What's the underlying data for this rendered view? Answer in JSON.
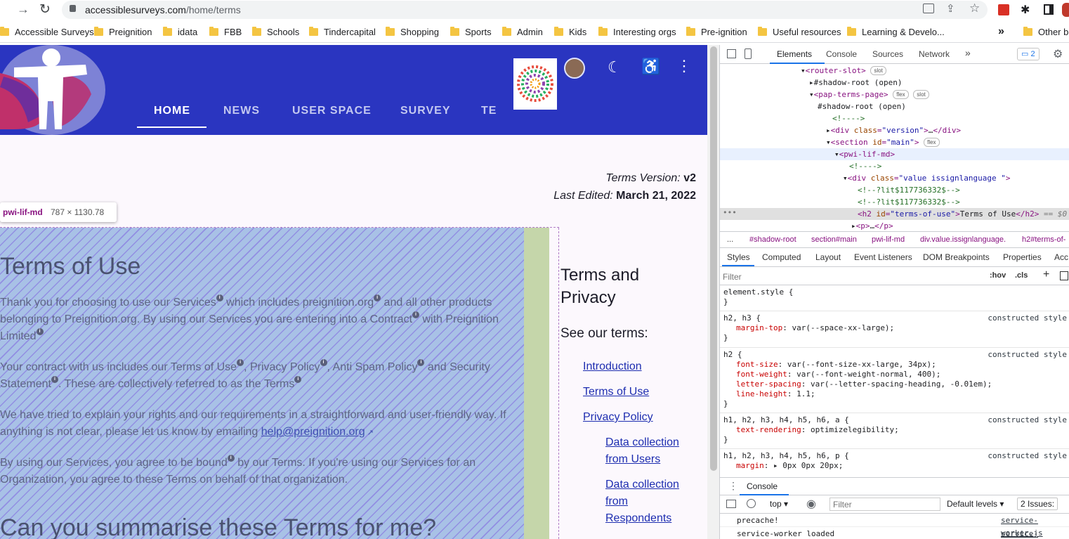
{
  "browser": {
    "url_domain": "accessiblesurveys.com",
    "url_path": "/home/terms",
    "bookmarks": [
      "Accessible Surveys",
      "Preignition",
      "idata",
      "FBB",
      "Schools",
      "Tindercapital",
      "Shopping",
      "Sports",
      "Admin",
      "Kids",
      "Interesting orgs",
      "Pre-ignition",
      "Useful resources",
      "Learning & Develo..."
    ],
    "bookmarks_more": "»",
    "other_bookmarks": "Other bo"
  },
  "page": {
    "nav": [
      "HOME",
      "NEWS",
      "USER SPACE",
      "SURVEY",
      "TE"
    ],
    "terms_version_label": "Terms Version:",
    "terms_version_value": "v2",
    "last_edited_label": "Last Edited:",
    "last_edited_value": "March 21, 2022",
    "inspect_tooltip_name": "pwi-lif-md",
    "inspect_tooltip_size": "787 × 1130.78",
    "heading": "Terms of Use",
    "para1": {
      "a": "Thank you for choosing to use our ",
      "b": "Services",
      "c": " which includes ",
      "d": "preignition.org",
      "e": " and all other products belonging to Preignition.org. By using our Services you are entering into a ",
      "f": "Contract",
      "g": " with ",
      "h": "Preignition Limited"
    },
    "para2": {
      "a": "Your contract with us includes our ",
      "b": "Terms of Use",
      "c": ", ",
      "d": "Privacy Policy",
      "e": ", ",
      "f": "Anti Spam Policy",
      "g": " and ",
      "h": "Security Statement",
      "i": ". These are collectively referred to as the ",
      "j": "Terms"
    },
    "para3": {
      "a": "We have tried to explain your rights and our requirements in a straightforward and user-friendly way. If anything is not clear, please let us know by emailing ",
      "email": "help@preignition.org"
    },
    "para4": {
      "a": "By using our Services, you agree to be ",
      "b": "bound",
      "c": " by our Terms. If you're using our Services for an Organization, you agree to these Terms on behalf of that organization."
    },
    "heading2": "Can you summarise these Terms for me?",
    "toc_title": "Terms and Privacy",
    "toc_subtitle": "See our terms:",
    "toc": [
      "Introduction",
      "Terms of Use",
      "Privacy Policy"
    ],
    "toc_sub": [
      "Data collection from Users",
      "Data collection from Respondents"
    ]
  },
  "devtools": {
    "tabs": [
      "Elements",
      "Console",
      "Sources",
      "Network"
    ],
    "more": "»",
    "issues_badge": "2",
    "dom_lines": [
      {
        "t": "<router-slot>",
        "pill": "slot"
      },
      {
        "t": "#shadow-root (open)"
      },
      {
        "t": "<pap-terms-page>",
        "pill1": "flex",
        "pill": "slot"
      },
      {
        "t": "#shadow-root (open)"
      },
      {
        "t": "<!---->"
      },
      {
        "t": "<div class=\"version\">…</div>"
      },
      {
        "t": "<section id=\"main\">",
        "pill": "flex"
      },
      {
        "t": "<pwi-lif-md>"
      },
      {
        "t": "<!---->"
      },
      {
        "t": "<div class=\"value  issignlanguage \">"
      },
      {
        "t": "<!--?lit$117736332$-->"
      },
      {
        "t": "<!--?lit$117736332$-->"
      },
      {
        "t": "<h2 id=\"terms-of-use\">Terms of Use</h2>",
        "eq": "== $0"
      },
      {
        "t": "<p>…</p>"
      }
    ],
    "breadcrumbs": [
      "...",
      "#shadow-root",
      "section#main",
      "pwi-lif-md",
      "div.value.issignlanguage.",
      "h2#terms-of-"
    ],
    "subtabs": [
      "Styles",
      "Computed",
      "Layout",
      "Event Listeners",
      "DOM Breakpoints",
      "Properties",
      "Acc"
    ],
    "filter_placeholder": "Filter",
    "hov": ":hov",
    "cls": ".cls",
    "rules": [
      {
        "sel": "element.style {",
        "props": [],
        "src": ""
      },
      {
        "sel": "h2, h3 {",
        "props": [
          [
            "margin-top",
            "var(--space-xx-large);"
          ]
        ],
        "src": "constructed style"
      },
      {
        "sel": "h2 {",
        "props": [
          [
            "font-size",
            "var(--font-size-xx-large, 34px);"
          ],
          [
            "font-weight",
            "var(--font-weight-normal, 400);"
          ],
          [
            "letter-spacing",
            "var(--letter-spacing-heading, -0.01em);"
          ],
          [
            "line-height",
            "1.1;"
          ]
        ],
        "src": "constructed style"
      },
      {
        "sel": "h1, h2, h3, h4, h5, h6, a {",
        "props": [
          [
            "text-rendering",
            "optimizelegibility;"
          ]
        ],
        "src": "constructed style"
      },
      {
        "sel": "h1, h2, h3, h4, h5, h6, p {",
        "props": [
          [
            "margin",
            "▸ 0px 0px 20px;"
          ]
        ],
        "src": "constructed style"
      }
    ],
    "console_tab": "Console",
    "console_top": "top",
    "console_filter": "Filter",
    "default_levels": "Default levels",
    "issues_count": "2 Issues:",
    "console_lines": [
      {
        "msg": "precache!",
        "src": "service-worker.js"
      },
      {
        "msg": "service-worker loaded",
        "src": "service-worker.js"
      }
    ]
  }
}
